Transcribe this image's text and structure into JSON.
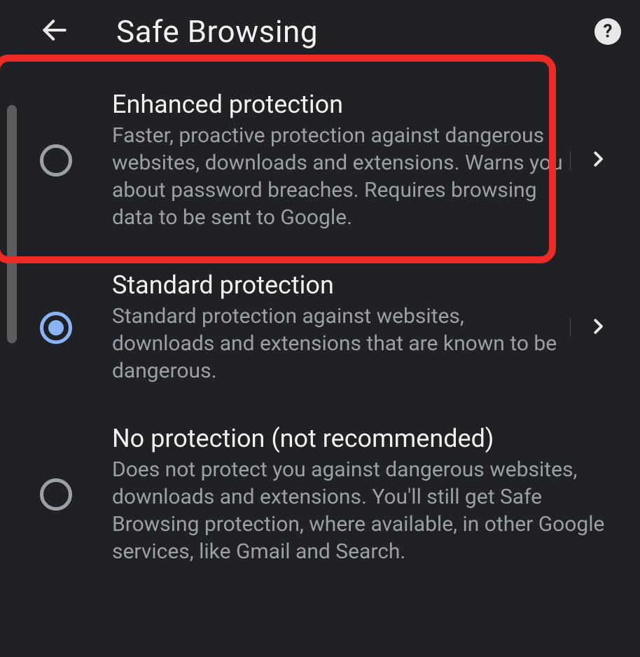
{
  "header": {
    "title": "Safe Browsing"
  },
  "options": [
    {
      "title": "Enhanced protection",
      "description": "Faster, proactive protection against dangerous websites, downloads and extensions. Warns you about password breaches. Requires browsing data to be sent to Google.",
      "selected": false,
      "hasChevron": true
    },
    {
      "title": "Standard protection",
      "description": "Standard protection against websites, downloads and extensions that are known to be dangerous.",
      "selected": true,
      "hasChevron": true
    },
    {
      "title": "No protection (not recommended)",
      "description": "Does not protect you against dangerous websites, downloads and extensions. You'll still get Safe Browsing protection, where available, in other Google services, like Gmail and Search.",
      "selected": false,
      "hasChevron": false
    }
  ],
  "annotation": {
    "highlight_option_index": 0
  }
}
